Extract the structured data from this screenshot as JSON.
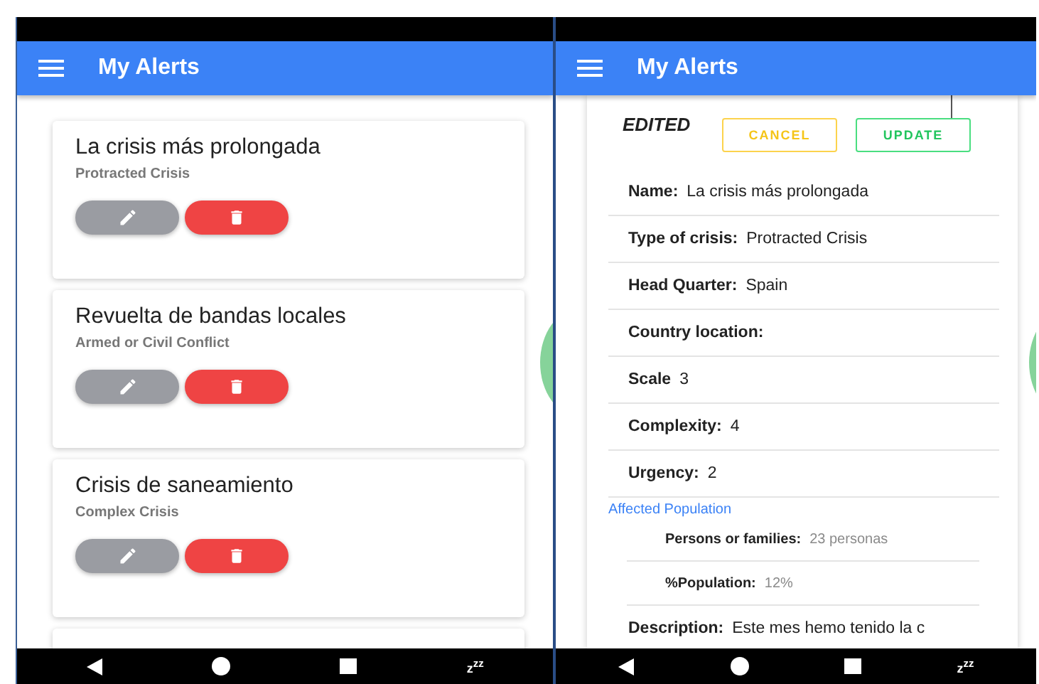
{
  "left_screen": {
    "app_bar": {
      "title": "My Alerts"
    },
    "alerts": [
      {
        "title": "La crisis más prolongada",
        "type": "Protracted Crisis"
      },
      {
        "title": "Revuelta de bandas locales",
        "type": "Armed or Civil Conflict"
      },
      {
        "title": "Crisis de saneamiento",
        "type": "Complex Crisis"
      }
    ],
    "nav_bar": {
      "sleep_label": "z$^{zz}$"
    }
  },
  "right_screen": {
    "app_bar": {
      "title": "My Alerts"
    },
    "status": "EDITED",
    "buttons": [
      {
        "label": "CANCEL",
        "kind": "cancel"
      },
      {
        "label": "UPDATE",
        "kind": "update"
      }
    ],
    "fields": [
      {
        "label": "Name:",
        "value": "La crisis más prolongada"
      },
      {
        "label": "Type of crisis:",
        "value": "Protracted Crisis"
      },
      {
        "label": "Head Quarter:",
        "value": "Spain"
      },
      {
        "label": "Country location:"
      },
      {
        "label": "Scale",
        "value": "3"
      },
      {
        "label": "Complexity:",
        "value": "4"
      },
      {
        "label": "Urgency:",
        "value": "2"
      }
    ],
    "section_title": "Affected Population",
    "sub_fields": [
      {
        "label": "Persons or families:",
        "value": "23 personas"
      },
      {
        "label": "%Population:",
        "value": "12%"
      }
    ],
    "description": {
      "label": "Description:",
      "value": "Este mes hemo tenido la c"
    },
    "nav_bar": {
      "sleep_label": "z$^{zz}$"
    }
  }
}
